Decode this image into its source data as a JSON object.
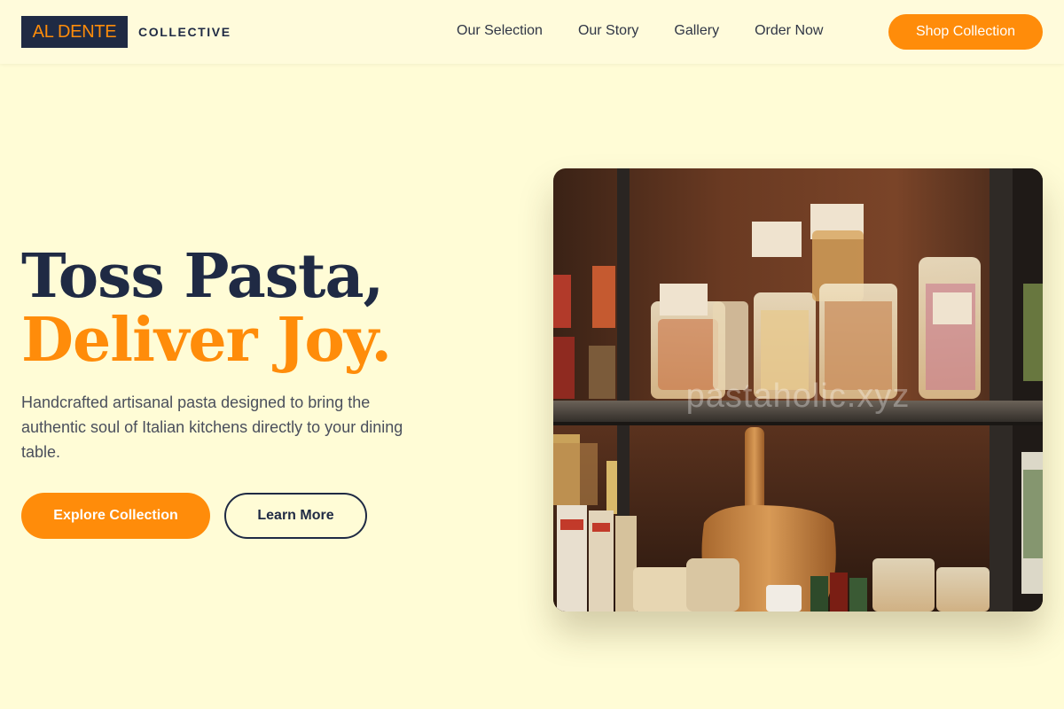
{
  "brand": {
    "mark": "AL DENTE",
    "word": "COLLECTIVE"
  },
  "nav": {
    "items": [
      "Our Selection",
      "Our Story",
      "Gallery",
      "Order Now"
    ],
    "cta": "Shop Collection"
  },
  "hero": {
    "title_line1": "Toss Pasta,",
    "title_line2": "Deliver Joy.",
    "description": "Handcrafted artisanal pasta designed to bring the authentic soul of Italian kitchens directly to your dining table.",
    "primary_button": "Explore Collection",
    "secondary_button": "Learn More"
  },
  "photo": {
    "watermark": "pastaholic.xyz"
  },
  "colors": {
    "background": "#FFFCD6",
    "accent": "#FF8C0A",
    "navy": "#1f2a44"
  }
}
